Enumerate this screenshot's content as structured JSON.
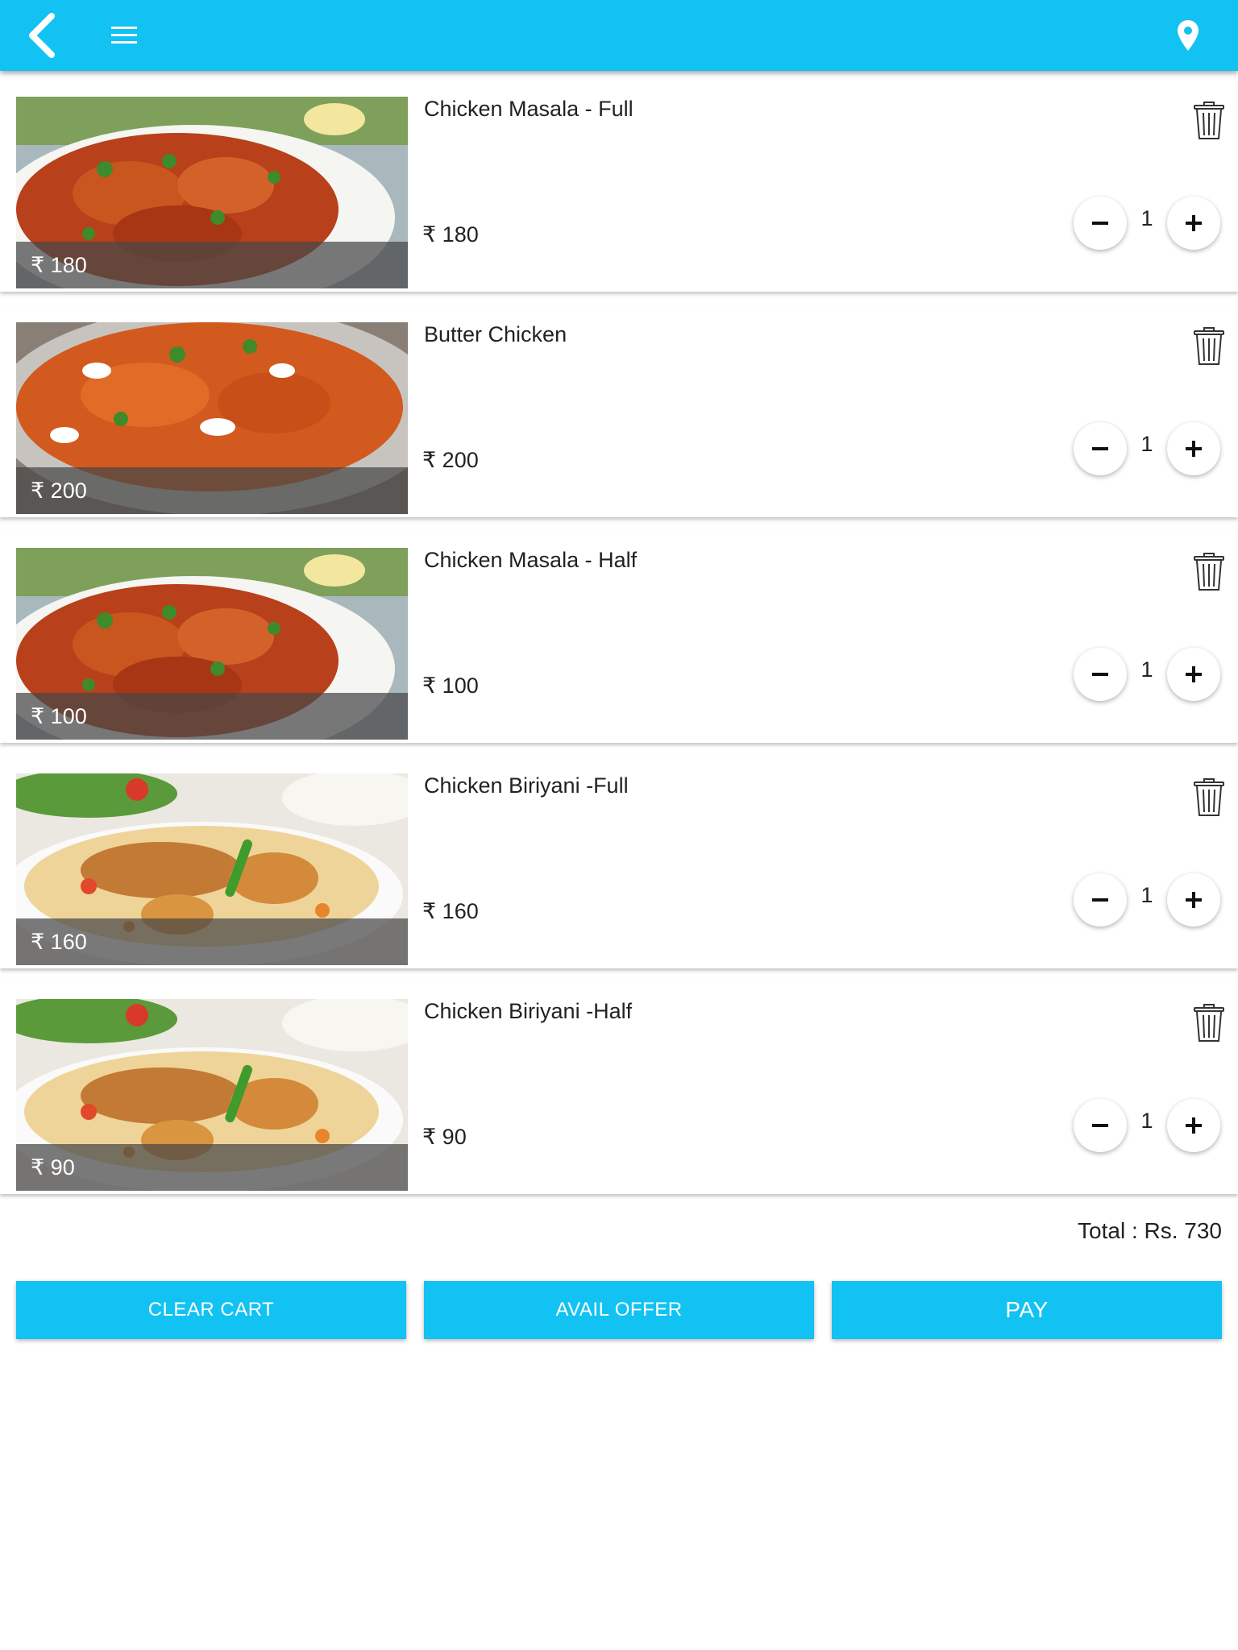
{
  "appbar": {
    "color": "#12c2f2",
    "back_icon": "chevron-left-icon",
    "menu_icon": "hamburger-menu-icon",
    "location_icon": "map-pin-icon"
  },
  "cart": {
    "items": [
      {
        "name": "Chicken Masala - Full",
        "image_label": "₹ 180",
        "price": "₹ 180",
        "quantity": "1",
        "image": "chicken-masala"
      },
      {
        "name": "Butter Chicken",
        "image_label": "₹ 200",
        "price": "₹ 200",
        "quantity": "1",
        "image": "butter-chicken"
      },
      {
        "name": "Chicken Masala - Half",
        "image_label": "₹ 100",
        "price": "₹ 100",
        "quantity": "1",
        "image": "chicken-masala"
      },
      {
        "name": "Chicken Biriyani -Full",
        "image_label": "₹ 160",
        "price": "₹ 160",
        "quantity": "1",
        "image": "chicken-biriyani"
      },
      {
        "name": "Chicken Biriyani -Half",
        "image_label": "₹ 90",
        "price": "₹ 90",
        "quantity": "1",
        "image": "chicken-biriyani"
      }
    ],
    "total": "Total : Rs. 730"
  },
  "actions": {
    "clear_label": "CLEAR CART",
    "offer_label": "AVAIL OFFER",
    "pay_label": "PAY"
  }
}
